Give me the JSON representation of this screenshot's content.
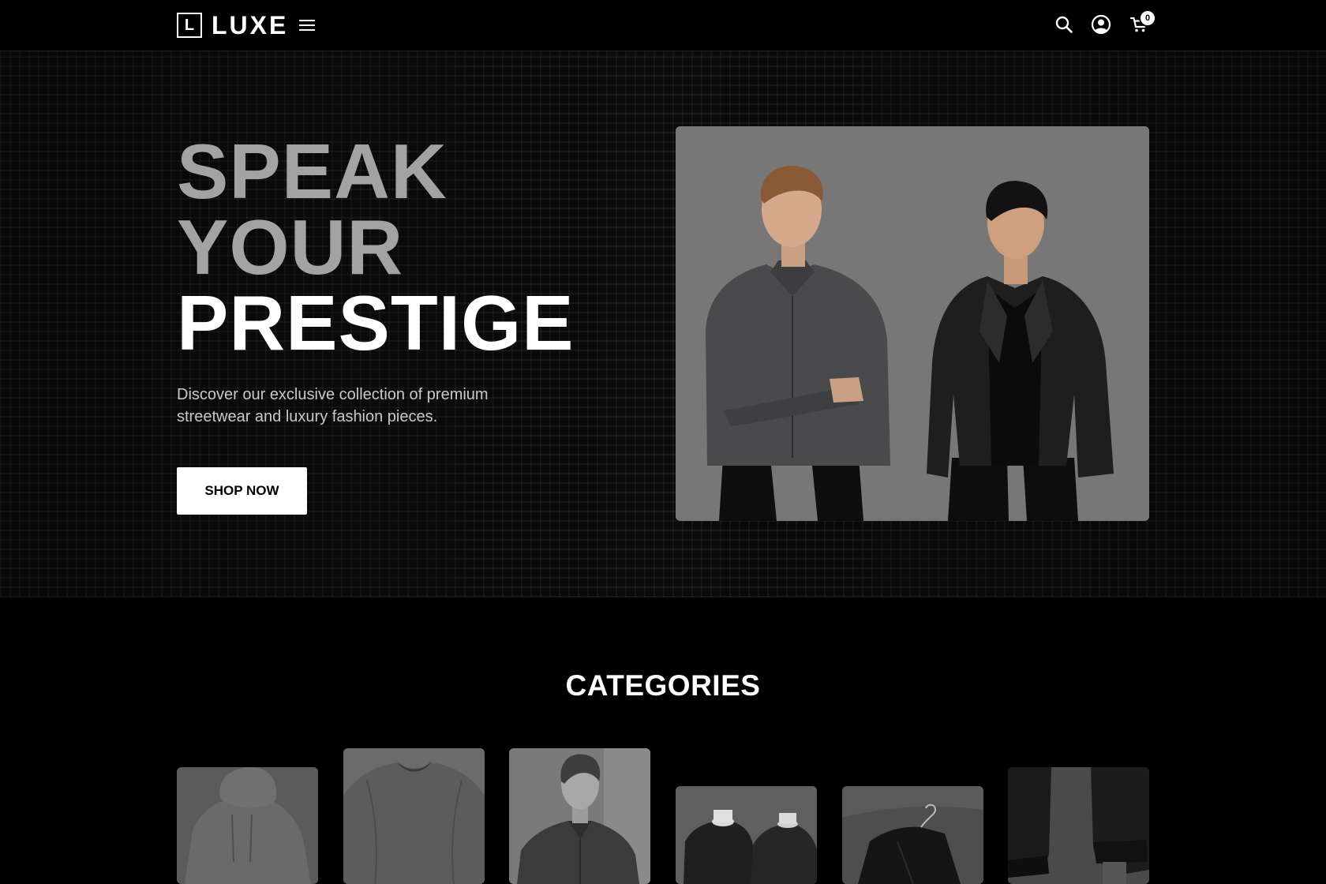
{
  "header": {
    "logo_mark": "L",
    "logo_text": "LUXE",
    "cart_count": "0",
    "icons": [
      "menu-icon",
      "search-icon",
      "user-icon",
      "cart-icon"
    ]
  },
  "hero": {
    "headline_line1": "SPEAK",
    "headline_line2": "YOUR",
    "headline_line3": "PRESTIGE",
    "description": "Discover our exclusive collection of premium streetwear and luxury fashion pieces.",
    "cta_label": "SHOP NOW"
  },
  "categories": {
    "title": "CATEGORIES"
  },
  "colors": {
    "background": "#000000",
    "accent": "#ffffff",
    "muted_headline": "#a3a3a3",
    "photo_backdrop": "#777777"
  }
}
